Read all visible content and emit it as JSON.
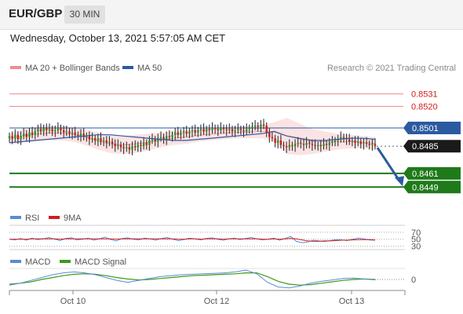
{
  "header": {
    "pair": "EUR/GBP",
    "timeframe": "30 MIN",
    "datetime": "Wednesday, October 13, 2021 5:57:05 AM CET"
  },
  "chart_data": {
    "type": "candlestick",
    "credit": "Research © 2021 Trading Central",
    "legend": [
      {
        "label": "MA 20 + Bollinger Bands",
        "color": "#f08c8c"
      },
      {
        "label": "MA 50",
        "color": "#2c5aa0"
      }
    ],
    "y_range": [
      0.8434,
      0.8548
    ],
    "close": [
      0.8494,
      0.8492,
      0.8495,
      0.8491,
      0.8494,
      0.8496,
      0.8493,
      0.8497,
      0.8495,
      0.8498,
      0.85,
      0.8498,
      0.8501,
      0.8499,
      0.85,
      0.8498,
      0.8499,
      0.8501,
      0.8499,
      0.8497,
      0.8498,
      0.8496,
      0.8497,
      0.8495,
      0.8494,
      0.8496,
      0.8493,
      0.8494,
      0.8491,
      0.8492,
      0.849,
      0.8492,
      0.8489,
      0.849,
      0.8488,
      0.8489,
      0.8487,
      0.8485,
      0.8486,
      0.8484,
      0.8483,
      0.8484,
      0.8482,
      0.8485,
      0.8484,
      0.8486,
      0.8485,
      0.8488,
      0.8486,
      0.849,
      0.8491,
      0.8489,
      0.8492,
      0.8493,
      0.8491,
      0.8494,
      0.8493,
      0.8495,
      0.8497,
      0.8495,
      0.8497,
      0.8498,
      0.8496,
      0.8498,
      0.8499,
      0.8497,
      0.8499,
      0.85,
      0.8498,
      0.85,
      0.8499,
      0.8501,
      0.85,
      0.8499,
      0.8501,
      0.85,
      0.8499,
      0.85,
      0.8498,
      0.8499,
      0.85,
      0.8499,
      0.8498,
      0.85,
      0.8501,
      0.8502,
      0.8503,
      0.8502,
      0.8504,
      0.8503,
      0.8497,
      0.8493,
      0.8492,
      0.8488,
      0.849,
      0.8486,
      0.8485,
      0.8484,
      0.8486,
      0.8485,
      0.8487,
      0.8488,
      0.8487,
      0.8486,
      0.8488,
      0.8487,
      0.8486,
      0.8485,
      0.8486,
      0.8485,
      0.8487,
      0.8486,
      0.8488,
      0.8489,
      0.849,
      0.8491,
      0.8493,
      0.8492,
      0.8491,
      0.8489,
      0.849,
      0.8488,
      0.8489,
      0.8487,
      0.8488,
      0.8487,
      0.8486,
      0.8487,
      0.8485
    ],
    "ma50": [
      0.8488,
      0.8489,
      0.849,
      0.8491,
      0.8492,
      0.8493,
      0.8494,
      0.8495,
      0.8495,
      0.8494,
      0.8493,
      0.8492,
      0.8491,
      0.849,
      0.849,
      0.8491,
      0.8492,
      0.8493,
      0.8494,
      0.8495,
      0.8496,
      0.8498,
      0.8494,
      0.8492,
      0.849,
      0.849,
      0.8491,
      0.8492,
      0.8492,
      0.8491
    ],
    "bb_upper": [
      0.8496,
      0.85,
      0.8502,
      0.8503,
      0.8503,
      0.8502,
      0.85,
      0.8497,
      0.8495,
      0.8494,
      0.8495,
      0.8496,
      0.8497,
      0.8498,
      0.8499,
      0.85,
      0.8501,
      0.8502,
      0.8502,
      0.8503,
      0.8504,
      0.8506,
      0.851,
      0.8505,
      0.85,
      0.8498,
      0.8496,
      0.8495,
      0.8494,
      0.8493
    ],
    "bb_lower": [
      0.8486,
      0.8488,
      0.8489,
      0.849,
      0.849,
      0.8489,
      0.8486,
      0.8482,
      0.8479,
      0.8478,
      0.8479,
      0.8481,
      0.8484,
      0.8486,
      0.8487,
      0.8489,
      0.849,
      0.8491,
      0.8492,
      0.8492,
      0.8492,
      0.8489,
      0.8478,
      0.8477,
      0.8478,
      0.848,
      0.8482,
      0.8483,
      0.8483,
      0.8482
    ],
    "levels": [
      {
        "value": "0.8531",
        "price": 0.8531,
        "kind": "resistance"
      },
      {
        "value": "0.8520",
        "price": 0.852,
        "kind": "resistance"
      },
      {
        "value": "0.8501",
        "price": 0.8501,
        "kind": "pivot"
      },
      {
        "value": "0.8485",
        "price": 0.8485,
        "kind": "last"
      },
      {
        "value": "0.8461",
        "price": 0.8461,
        "kind": "support"
      },
      {
        "value": "0.8449",
        "price": 0.8449,
        "kind": "support"
      }
    ],
    "forecast_arrow": {
      "from": 0.8485,
      "to": 0.8449,
      "direction": "down"
    },
    "rsi": {
      "legend": [
        {
          "label": "RSI",
          "color": "#5b8ad8"
        },
        {
          "label": "9MA",
          "color": "#d01c1c"
        }
      ],
      "levels": [
        "70",
        "50",
        "30"
      ],
      "rsi_values": [
        50,
        48,
        52,
        47,
        53,
        49,
        51,
        55,
        50,
        46,
        52,
        54,
        48,
        50,
        53,
        47,
        51,
        56,
        49,
        45,
        52,
        54,
        50,
        48,
        53,
        51,
        47,
        52,
        55,
        50,
        46,
        49,
        53,
        51,
        48,
        52,
        54,
        50,
        47,
        51,
        53,
        49,
        52,
        55,
        51,
        48,
        50,
        53,
        47,
        52,
        58,
        44,
        40,
        42,
        47,
        45,
        43,
        46,
        49,
        48,
        46,
        50,
        53,
        51,
        48,
        47
      ],
      "ma_values": [
        50,
        50,
        50,
        50,
        51,
        51,
        51,
        51,
        51,
        50,
        51,
        51,
        51,
        51,
        51,
        51,
        51,
        51,
        51,
        50,
        51,
        51,
        51,
        51,
        51,
        51,
        51,
        51,
        51,
        51,
        50,
        50,
        51,
        51,
        50,
        51,
        51,
        51,
        50,
        51,
        51,
        51,
        51,
        51,
        51,
        50,
        50,
        51,
        50,
        51,
        52,
        51,
        48,
        45,
        44,
        44,
        45,
        45,
        46,
        47,
        47,
        48,
        49,
        49,
        49,
        48
      ]
    },
    "macd": {
      "legend": [
        {
          "label": "MACD",
          "color": "#5b8ad8"
        },
        {
          "label": "MACD Signal",
          "color": "#3e9a1a"
        }
      ],
      "zero_label": "0",
      "macd_values": [
        -0.6,
        -0.4,
        -0.1,
        0.2,
        0.5,
        0.7,
        0.8,
        0.7,
        0.5,
        0.2,
        -0.1,
        -0.3,
        -0.1,
        0.1,
        0.3,
        0.4,
        0.5,
        0.55,
        0.6,
        0.65,
        0.7,
        0.8,
        1.0,
        0.6,
        -0.3,
        -0.8,
        -0.9,
        -0.7,
        -0.4,
        -0.2,
        -0.05,
        0.1,
        0.15,
        0.05,
        -0.05
      ],
      "signal_values": [
        -0.5,
        -0.4,
        -0.25,
        0.0,
        0.2,
        0.4,
        0.55,
        0.6,
        0.55,
        0.4,
        0.2,
        0.05,
        -0.05,
        0.0,
        0.1,
        0.2,
        0.3,
        0.4,
        0.45,
        0.5,
        0.55,
        0.6,
        0.7,
        0.7,
        0.3,
        -0.2,
        -0.5,
        -0.6,
        -0.55,
        -0.4,
        -0.25,
        -0.1,
        0.0,
        0.05,
        0.0
      ]
    },
    "x_labels": [
      "Oct 10",
      "Oct 12",
      "Oct 13"
    ]
  }
}
